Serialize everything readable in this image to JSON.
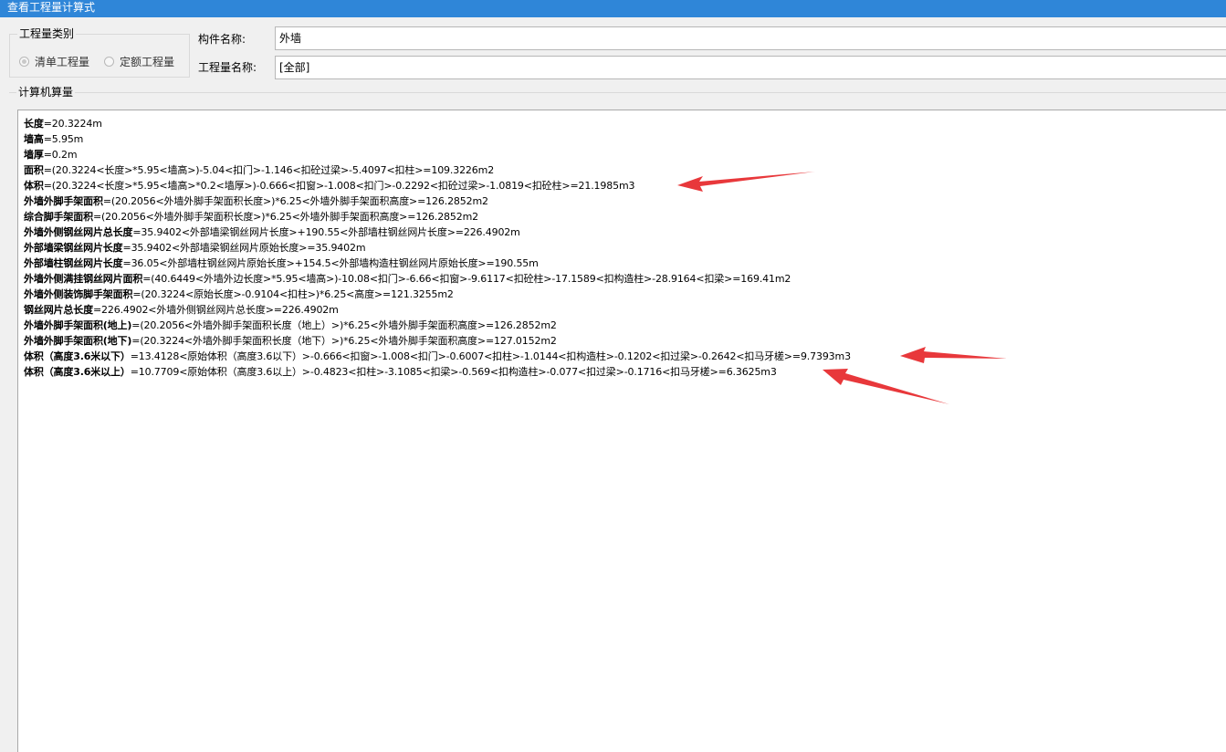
{
  "window": {
    "title": "查看工程量计算式"
  },
  "category_group": {
    "legend": "工程量类别",
    "options": [
      {
        "label": "清单工程量",
        "checked": true
      },
      {
        "label": "定额工程量",
        "checked": false
      }
    ]
  },
  "component": {
    "label": "构件名称:",
    "value": "外墙"
  },
  "quantity": {
    "label": "工程量名称:",
    "value": "[全部]"
  },
  "calc_section": {
    "label": "计算机算量"
  },
  "calc_lines": [
    {
      "name": "长度",
      "expr": "=20.3224m"
    },
    {
      "name": "墙高",
      "expr": "=5.95m"
    },
    {
      "name": "墙厚",
      "expr": "=0.2m"
    },
    {
      "name": "面积",
      "expr": "=(20.3224<长度>*5.95<墙高>)-5.04<扣门>-1.146<扣砼过梁>-5.4097<扣柱>=109.3226m2"
    },
    {
      "name": "体积",
      "expr": "=(20.3224<长度>*5.95<墙高>*0.2<墙厚>)-0.666<扣窗>-1.008<扣门>-0.2292<扣砼过梁>-1.0819<扣砼柱>=21.1985m3"
    },
    {
      "name": "外墙外脚手架面积",
      "expr": "=(20.2056<外墙外脚手架面积长度>)*6.25<外墙外脚手架面积高度>=126.2852m2"
    },
    {
      "name": "综合脚手架面积",
      "expr": "=(20.2056<外墙外脚手架面积长度>)*6.25<外墙外脚手架面积高度>=126.2852m2"
    },
    {
      "name": "外墙外侧钢丝网片总长度",
      "expr": "=35.9402<外部墙梁钢丝网片长度>+190.55<外部墙柱钢丝网片长度>=226.4902m"
    },
    {
      "name": "外部墙梁钢丝网片长度",
      "expr": "=35.9402<外部墙梁钢丝网片原始长度>=35.9402m"
    },
    {
      "name": "外部墙柱钢丝网片长度",
      "expr": "=36.05<外部墙柱钢丝网片原始长度>+154.5<外部墙构造柱钢丝网片原始长度>=190.55m"
    },
    {
      "name": "外墙外侧满挂钢丝网片面积",
      "expr": "=(40.6449<外墙外边长度>*5.95<墙高>)-10.08<扣门>-6.66<扣窗>-9.6117<扣砼柱>-17.1589<扣构造柱>-28.9164<扣梁>=169.41m2"
    },
    {
      "name": "外墙外侧装饰脚手架面积",
      "expr": "=(20.3224<原始长度>-0.9104<扣柱>)*6.25<高度>=121.3255m2"
    },
    {
      "name": "钢丝网片总长度",
      "expr": "=226.4902<外墙外侧钢丝网片总长度>=226.4902m"
    },
    {
      "name": "外墙外脚手架面积(地上)",
      "expr": "=(20.2056<外墙外脚手架面积长度（地上）>)*6.25<外墙外脚手架面积高度>=126.2852m2"
    },
    {
      "name": "外墙外脚手架面积(地下)",
      "expr": "=(20.3224<外墙外脚手架面积长度（地下）>)*6.25<外墙外脚手架面积高度>=127.0152m2"
    },
    {
      "name": "体积（高度3.6米以下）",
      "expr": "=13.4128<原始体积（高度3.6以下）>-0.666<扣窗>-1.008<扣门>-0.6007<扣柱>-1.0144<扣构造柱>-0.1202<扣过梁>-0.2642<扣马牙槎>=9.7393m3"
    },
    {
      "name": "体积（高度3.6米以上）",
      "expr": "=10.7709<原始体积（高度3.6以上）>-0.4823<扣柱>-3.1085<扣梁>-0.569<扣构造柱>-0.077<扣过梁>-0.1716<扣马牙槎>=6.3625m3"
    }
  ],
  "colors": {
    "titlebar": "#2f86d8",
    "annotation_arrow": "#e8383b"
  }
}
